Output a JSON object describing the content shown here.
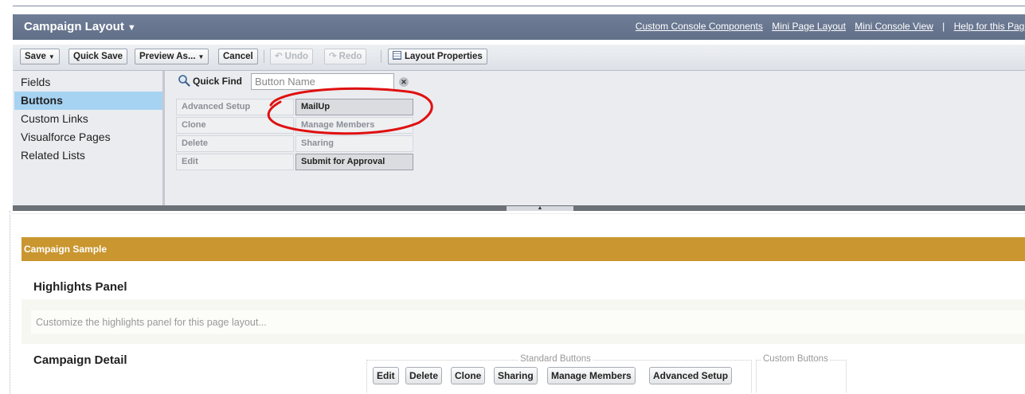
{
  "header": {
    "title": "Campaign Layout",
    "links": [
      "Custom Console Components",
      "Mini Page Layout",
      "Mini Console View",
      "|",
      "Help for this Page"
    ]
  },
  "toolbar": {
    "save": "Save",
    "quick_save": "Quick Save",
    "preview_as": "Preview As...",
    "cancel": "Cancel",
    "undo": "Undo",
    "redo": "Redo",
    "layout_properties": "Layout Properties"
  },
  "palette": {
    "categories": [
      "Fields",
      "Buttons",
      "Custom Links",
      "Visualforce Pages",
      "Related Lists"
    ],
    "active_category": "Buttons",
    "quick_find_label": "Quick Find",
    "quick_find_placeholder": "Button Name",
    "buttons": [
      "Advanced Setup",
      "MailUp",
      "Clone",
      "Manage Members",
      "Delete",
      "Sharing",
      "Edit",
      "Submit for Approval"
    ]
  },
  "canvas": {
    "section_title": "Campaign Sample",
    "highlights_title": "Highlights Panel",
    "highlights_hint": "Customize the highlights panel for this page layout...",
    "detail_title": "Campaign Detail",
    "standard_buttons_label": "Standard Buttons",
    "custom_buttons_label": "Custom Buttons",
    "standard_buttons": [
      "Edit",
      "Delete",
      "Clone",
      "Sharing",
      "Manage Members",
      "Advanced Setup"
    ]
  },
  "colors": {
    "header_bg": "#616f88",
    "section_bar": "#c9962f",
    "active_category": "#a7d3f2",
    "annotation": "#e01010"
  }
}
